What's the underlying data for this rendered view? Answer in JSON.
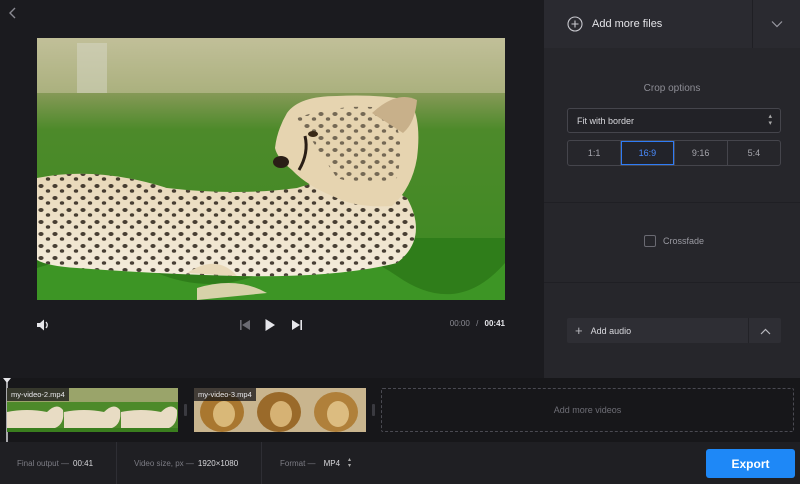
{
  "player": {
    "time_current": "00:00",
    "time_separator": "/",
    "time_total": "00:41"
  },
  "panel": {
    "add_files_label": "Add more files",
    "crop_title": "Crop options",
    "crop_mode": "Fit with border",
    "ratios": [
      "1:1",
      "16:9",
      "9:16",
      "5:4"
    ],
    "active_ratio": "16:9",
    "crossfade_label": "Crossfade",
    "crossfade_checked": false,
    "add_audio_label": "Add audio"
  },
  "timeline": {
    "clips": [
      {
        "name": "my-video-2.mp4"
      },
      {
        "name": "my-video-3.mp4"
      }
    ],
    "add_videos_label": "Add more videos"
  },
  "bottom": {
    "final_output_label": "Final output —",
    "final_output_value": "00:41",
    "video_size_label": "Video size, px —",
    "video_size_value": "1920×1080",
    "format_label": "Format —",
    "format_value": "MP4",
    "export_label": "Export"
  },
  "colors": {
    "accent": "#1e88f7",
    "active_ratio": "#2f7cf6",
    "background": "#1b1b1f",
    "panel": "#26262b"
  }
}
